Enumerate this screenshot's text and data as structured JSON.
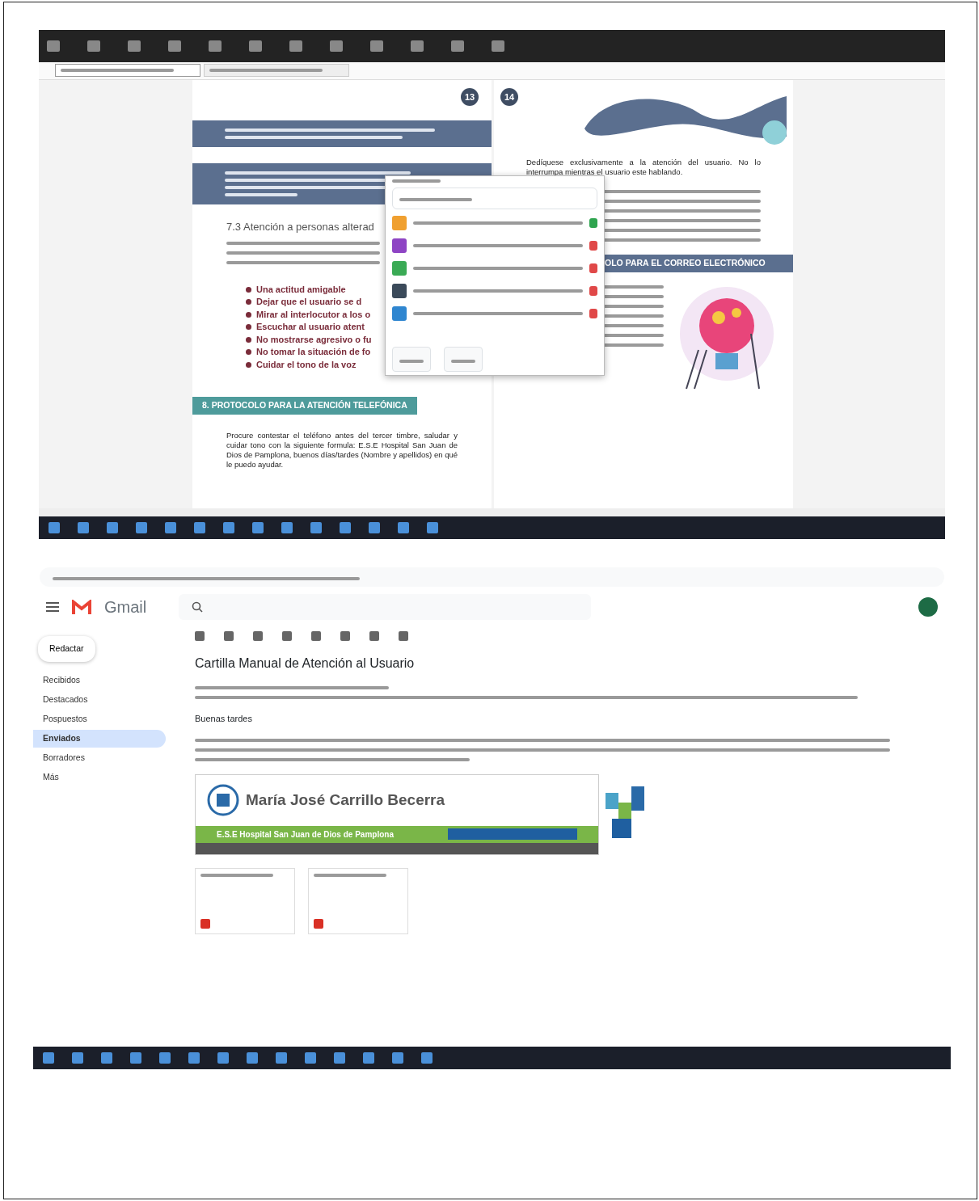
{
  "meeting_screenshot": {
    "tabs": [
      {
        "selected": true
      },
      {
        "selected": false
      }
    ],
    "left_page": {
      "page_number": "13",
      "heading": "7.3 Atención a personas alterad",
      "bullets": [
        "Una actitud amigable",
        "Dejar que el usuario se d",
        "Mirar al interlocutor a los o",
        "Escuchar al usuario atent",
        "No mostrarse agresivo o fu",
        "No tomar la situación de fo",
        "Cuidar el tono de la voz"
      ],
      "section_title": "8. PROTOCOLO PARA LA ATENCIÓN TELEFÓNICA",
      "paragraph": "Procure contestar el teléfono antes del tercer timbre, saludar y cuidar tono con la siguiente formula: E.S.E Hospital San Juan de Dios de Pamplona, buenos días/tardes (Nombre y apellidos) en qué le puedo ayudar."
    },
    "right_page": {
      "page_number": "14",
      "paragraph": "Dedíquese exclusivamente a la atención del usuario. No lo interrumpa mientras el usuario este hablando.",
      "section_title": "OLO PARA EL CORREO ELECTRÓNICO"
    },
    "participants": [
      {
        "color": "#f0a030",
        "muted": false
      },
      {
        "color": "#8e44c4",
        "muted": true
      },
      {
        "color": "#3aaa55",
        "muted": true
      },
      {
        "color": "#3b4a5a",
        "muted": true
      },
      {
        "color": "#2f86d0",
        "muted": true
      }
    ]
  },
  "mail_screenshot": {
    "app_name": "Gmail",
    "compose": "Redactar",
    "folders": [
      {
        "label": "Recibidos",
        "selected": false
      },
      {
        "label": "Destacados",
        "selected": false
      },
      {
        "label": "Pospuestos",
        "selected": false
      },
      {
        "label": "Enviados",
        "selected": true
      },
      {
        "label": "Borradores",
        "selected": false
      },
      {
        "label": "Más",
        "selected": false
      }
    ],
    "subject": "Cartilla Manual de Atención al Usuario",
    "greeting": "Buenas tardes",
    "signature": {
      "name": "María José Carrillo Becerra",
      "organization": "E.S.E Hospital San Juan de Dios de Pamplona"
    },
    "attachments": [
      {
        "kind": "pdf"
      },
      {
        "kind": "pdf"
      }
    ]
  }
}
